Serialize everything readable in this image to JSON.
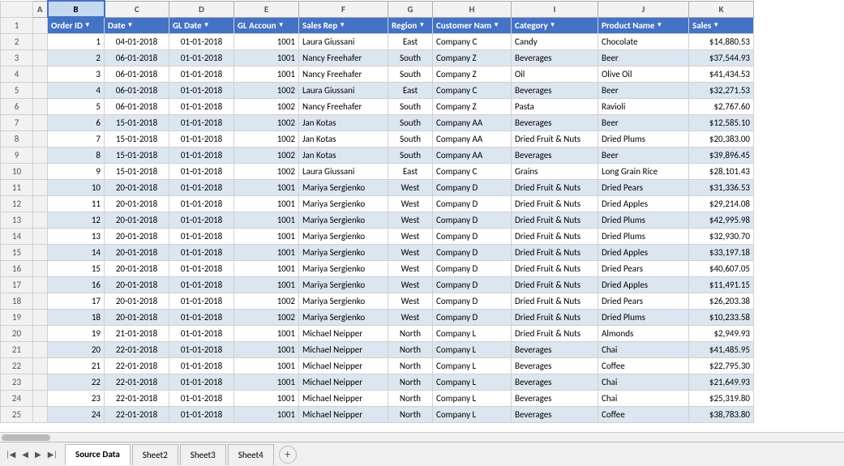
{
  "columns": {
    "row_num": "",
    "a": "A",
    "b": "B",
    "c": "C",
    "d": "D",
    "e": "E",
    "f": "F",
    "g": "G",
    "h": "H",
    "i": "I",
    "j": "J",
    "k": "K"
  },
  "headers": {
    "order_id": "Order ID",
    "date": "Date",
    "gl_date": "GL Date",
    "gl_account": "GL Accoun",
    "sales_rep": "Sales Rep",
    "region": "Region",
    "customer_name": "Customer Nam",
    "category": "Category",
    "product_name": "Product Name",
    "sales": "Sales"
  },
  "rows": [
    {
      "row": 2,
      "order_id": "1",
      "date": "04-01-2018",
      "gl_date": "01-01-2018",
      "gl_account": "1001",
      "sales_rep": "Laura Giussani",
      "region": "East",
      "customer": "Company C",
      "category": "Candy",
      "product": "Chocolate",
      "sales": "$14,880.53"
    },
    {
      "row": 3,
      "order_id": "2",
      "date": "06-01-2018",
      "gl_date": "01-01-2018",
      "gl_account": "1001",
      "sales_rep": "Nancy Freehafer",
      "region": "South",
      "customer": "Company Z",
      "category": "Beverages",
      "product": "Beer",
      "sales": "$37,544.93"
    },
    {
      "row": 4,
      "order_id": "3",
      "date": "06-01-2018",
      "gl_date": "01-01-2018",
      "gl_account": "1001",
      "sales_rep": "Nancy Freehafer",
      "region": "South",
      "customer": "Company Z",
      "category": "Oil",
      "product": "Olive Oil",
      "sales": "$41,434.53"
    },
    {
      "row": 5,
      "order_id": "4",
      "date": "06-01-2018",
      "gl_date": "01-01-2018",
      "gl_account": "1002",
      "sales_rep": "Laura Giussani",
      "region": "East",
      "customer": "Company C",
      "category": "Beverages",
      "product": "Beer",
      "sales": "$32,271.53"
    },
    {
      "row": 6,
      "order_id": "5",
      "date": "06-01-2018",
      "gl_date": "01-01-2018",
      "gl_account": "1002",
      "sales_rep": "Nancy Freehafer",
      "region": "South",
      "customer": "Company Z",
      "category": "Pasta",
      "product": "Ravioli",
      "sales": "$2,767.60"
    },
    {
      "row": 7,
      "order_id": "6",
      "date": "15-01-2018",
      "gl_date": "01-01-2018",
      "gl_account": "1002",
      "sales_rep": "Jan Kotas",
      "region": "South",
      "customer": "Company AA",
      "category": "Beverages",
      "product": "Beer",
      "sales": "$12,585.10"
    },
    {
      "row": 8,
      "order_id": "7",
      "date": "15-01-2018",
      "gl_date": "01-01-2018",
      "gl_account": "1002",
      "sales_rep": "Jan Kotas",
      "region": "South",
      "customer": "Company AA",
      "category": "Dried Fruit & Nuts",
      "product": "Dried Plums",
      "sales": "$20,383.00"
    },
    {
      "row": 9,
      "order_id": "8",
      "date": "15-01-2018",
      "gl_date": "01-01-2018",
      "gl_account": "1002",
      "sales_rep": "Jan Kotas",
      "region": "South",
      "customer": "Company AA",
      "category": "Beverages",
      "product": "Beer",
      "sales": "$39,896.45"
    },
    {
      "row": 10,
      "order_id": "9",
      "date": "15-01-2018",
      "gl_date": "01-01-2018",
      "gl_account": "1002",
      "sales_rep": "Laura Giussani",
      "region": "East",
      "customer": "Company C",
      "category": "Grains",
      "product": "Long Grain Rice",
      "sales": "$28,101.43"
    },
    {
      "row": 11,
      "order_id": "10",
      "date": "20-01-2018",
      "gl_date": "01-01-2018",
      "gl_account": "1001",
      "sales_rep": "Mariya Sergienko",
      "region": "West",
      "customer": "Company D",
      "category": "Dried Fruit & Nuts",
      "product": "Dried Pears",
      "sales": "$31,336.53"
    },
    {
      "row": 12,
      "order_id": "11",
      "date": "20-01-2018",
      "gl_date": "01-01-2018",
      "gl_account": "1001",
      "sales_rep": "Mariya Sergienko",
      "region": "West",
      "customer": "Company D",
      "category": "Dried Fruit & Nuts",
      "product": "Dried Apples",
      "sales": "$29,214.08"
    },
    {
      "row": 13,
      "order_id": "12",
      "date": "20-01-2018",
      "gl_date": "01-01-2018",
      "gl_account": "1001",
      "sales_rep": "Mariya Sergienko",
      "region": "West",
      "customer": "Company D",
      "category": "Dried Fruit & Nuts",
      "product": "Dried Plums",
      "sales": "$42,995.98"
    },
    {
      "row": 14,
      "order_id": "13",
      "date": "20-01-2018",
      "gl_date": "01-01-2018",
      "gl_account": "1001",
      "sales_rep": "Mariya Sergienko",
      "region": "West",
      "customer": "Company D",
      "category": "Dried Fruit & Nuts",
      "product": "Dried Plums",
      "sales": "$32,930.70"
    },
    {
      "row": 15,
      "order_id": "14",
      "date": "20-01-2018",
      "gl_date": "01-01-2018",
      "gl_account": "1001",
      "sales_rep": "Mariya Sergienko",
      "region": "West",
      "customer": "Company D",
      "category": "Dried Fruit & Nuts",
      "product": "Dried Apples",
      "sales": "$33,197.18"
    },
    {
      "row": 16,
      "order_id": "15",
      "date": "20-01-2018",
      "gl_date": "01-01-2018",
      "gl_account": "1001",
      "sales_rep": "Mariya Sergienko",
      "region": "West",
      "customer": "Company D",
      "category": "Dried Fruit & Nuts",
      "product": "Dried Pears",
      "sales": "$40,607.05"
    },
    {
      "row": 17,
      "order_id": "16",
      "date": "20-01-2018",
      "gl_date": "01-01-2018",
      "gl_account": "1001",
      "sales_rep": "Mariya Sergienko",
      "region": "West",
      "customer": "Company D",
      "category": "Dried Fruit & Nuts",
      "product": "Dried Apples",
      "sales": "$11,491.15"
    },
    {
      "row": 18,
      "order_id": "17",
      "date": "20-01-2018",
      "gl_date": "01-01-2018",
      "gl_account": "1002",
      "sales_rep": "Mariya Sergienko",
      "region": "West",
      "customer": "Company D",
      "category": "Dried Fruit & Nuts",
      "product": "Dried Pears",
      "sales": "$26,203.38"
    },
    {
      "row": 19,
      "order_id": "18",
      "date": "20-01-2018",
      "gl_date": "01-01-2018",
      "gl_account": "1002",
      "sales_rep": "Mariya Sergienko",
      "region": "West",
      "customer": "Company D",
      "category": "Dried Fruit & Nuts",
      "product": "Dried Plums",
      "sales": "$10,233.58"
    },
    {
      "row": 20,
      "order_id": "19",
      "date": "21-01-2018",
      "gl_date": "01-01-2018",
      "gl_account": "1001",
      "sales_rep": "Michael Neipper",
      "region": "North",
      "customer": "Company L",
      "category": "Dried Fruit & Nuts",
      "product": "Almonds",
      "sales": "$2,949.93"
    },
    {
      "row": 21,
      "order_id": "20",
      "date": "22-01-2018",
      "gl_date": "01-01-2018",
      "gl_account": "1001",
      "sales_rep": "Michael Neipper",
      "region": "North",
      "customer": "Company L",
      "category": "Beverages",
      "product": "Chai",
      "sales": "$41,485.95"
    },
    {
      "row": 22,
      "order_id": "21",
      "date": "22-01-2018",
      "gl_date": "01-01-2018",
      "gl_account": "1001",
      "sales_rep": "Michael Neipper",
      "region": "North",
      "customer": "Company L",
      "category": "Beverages",
      "product": "Coffee",
      "sales": "$22,795.30"
    },
    {
      "row": 23,
      "order_id": "22",
      "date": "22-01-2018",
      "gl_date": "01-01-2018",
      "gl_account": "1001",
      "sales_rep": "Michael Neipper",
      "region": "North",
      "customer": "Company L",
      "category": "Beverages",
      "product": "Chai",
      "sales": "$21,649.93"
    },
    {
      "row": 24,
      "order_id": "23",
      "date": "22-01-2018",
      "gl_date": "01-01-2018",
      "gl_account": "1001",
      "sales_rep": "Michael Neipper",
      "region": "North",
      "customer": "Company L",
      "category": "Beverages",
      "product": "Chai",
      "sales": "$25,319.80"
    },
    {
      "row": 25,
      "order_id": "24",
      "date": "22-01-2018",
      "gl_date": "01-01-2018",
      "gl_account": "1001",
      "sales_rep": "Michael Neipper",
      "region": "North",
      "customer": "Company L",
      "category": "Beverages",
      "product": "Coffee",
      "sales": "$38,783.80"
    }
  ],
  "tabs": [
    "Source Data",
    "Sheet2",
    "Sheet3",
    "Sheet4"
  ],
  "active_tab": "Source Data"
}
